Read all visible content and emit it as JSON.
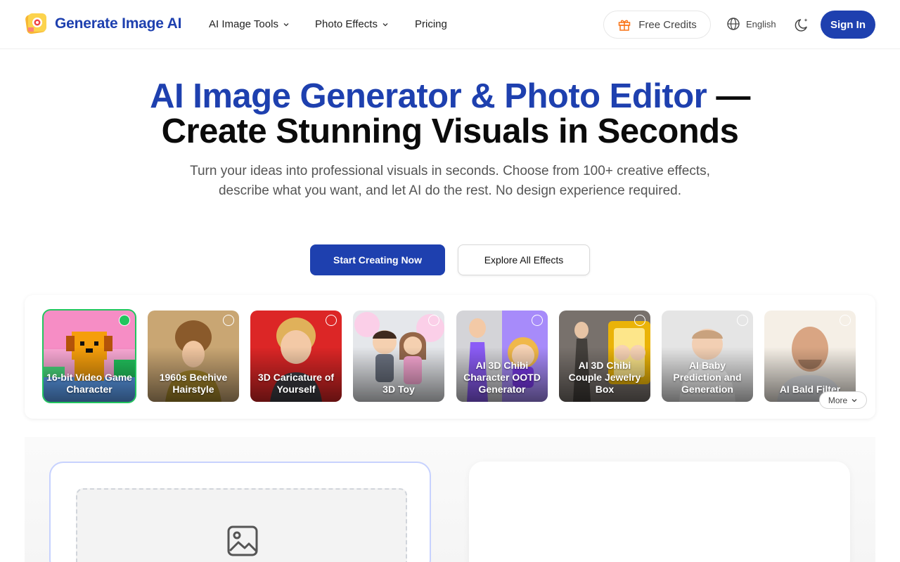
{
  "header": {
    "brand": "Generate Image AI",
    "nav": [
      {
        "label": "AI Image Tools",
        "has_dropdown": true
      },
      {
        "label": "Photo Effects",
        "has_dropdown": true
      },
      {
        "label": "Pricing",
        "has_dropdown": false
      }
    ],
    "credits_label": "Free Credits",
    "language": "English",
    "sign_in": "Sign In"
  },
  "hero": {
    "title_highlight": "AI Image Generator & Photo Editor",
    "title_dash": " —",
    "title_line2": "Create Stunning Visuals in Seconds",
    "subtitle": "Turn your ideas into professional visuals in seconds. Choose from 100+ creative effects, describe what you want, and let AI do the rest. No design experience required.",
    "primary_cta": "Start Creating Now",
    "secondary_cta": "Explore All Effects"
  },
  "effects": {
    "selected_index": 0,
    "items": [
      {
        "label": "16-bit Video Game Character"
      },
      {
        "label": "1960s Beehive Hairstyle"
      },
      {
        "label": "3D Caricature of Yourself"
      },
      {
        "label": "3D Toy"
      },
      {
        "label": "AI 3D Chibi Character OOTD Generator"
      },
      {
        "label": "AI 3D Chibi Couple Jewelry Box"
      },
      {
        "label": "AI Baby Prediction and Generation"
      },
      {
        "label": "AI Bald Filter"
      }
    ],
    "more_label": "More"
  },
  "colors": {
    "brand_blue": "#1e40af",
    "selected_green": "#22c55e",
    "credits_orange": "#f97316"
  }
}
